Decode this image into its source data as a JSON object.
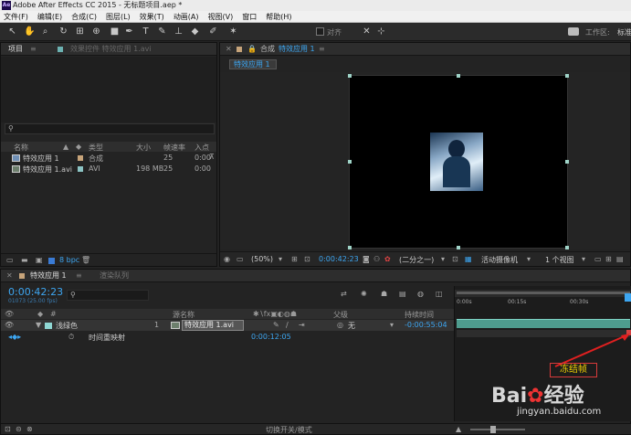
{
  "title_bar": {
    "logo": "Ae",
    "title": "Adobe After Effects CC 2015 - 无标题项目.aep *"
  },
  "menu": [
    "文件(F)",
    "编辑(E)",
    "合成(C)",
    "图层(L)",
    "效果(T)",
    "动画(A)",
    "视图(V)",
    "窗口",
    "帮助(H)"
  ],
  "toolbar": {
    "snap_label": "对齐",
    "workspace_label": "工作区:",
    "workspace_value": "标准"
  },
  "project_panel": {
    "tab_label": "项目",
    "effects_tab_label": "效果控件 特效应用 1.avi",
    "search_icon": "search-icon",
    "columns": [
      "名称",
      "类型",
      "大小",
      "帧速率",
      "入点"
    ],
    "items": [
      {
        "name": "特效应用 1",
        "type": "合成",
        "size": "",
        "fps": "25",
        "in": "0:00"
      },
      {
        "name": "特效应用 1.avi",
        "type": "AVI",
        "size": "198 MB",
        "fps": "25",
        "in": "0:00"
      }
    ],
    "bpc": "8 bpc"
  },
  "comp_panel": {
    "tab_prefix": "合成",
    "tab_name": "特效应用 1",
    "sub_tab": "特效应用 1",
    "zoom": "(50%)",
    "timecode": "0:00:42:23",
    "resolution": "(二分之一)",
    "camera": "活动摄像机",
    "views": "1 个视图"
  },
  "timeline": {
    "tab_label": "特效应用 1",
    "render_tab_label": "渲染队列",
    "timecode": "0:00:42:23",
    "frame_info": "01073 (25.00 fps)",
    "search_placeholder": "",
    "col_layer_name": "源名称",
    "col_parent": "父级",
    "col_duration": "持续时间",
    "layer": {
      "label": "浅绿色",
      "index": "1",
      "source": "特效应用 1.avi",
      "parent": "无",
      "duration": "-0:00:55:04"
    },
    "sub_property": {
      "name": "时间重映射",
      "value": "0:00:12:05"
    },
    "ruler": [
      "0:00s",
      "00:15s",
      "00:30s"
    ],
    "toggle_label": "切换开关/模式",
    "annotation": "冻结帧"
  },
  "watermark": {
    "brand": "Bai",
    "brand_cn": "经验",
    "url": "jingyan.baidu.com"
  }
}
